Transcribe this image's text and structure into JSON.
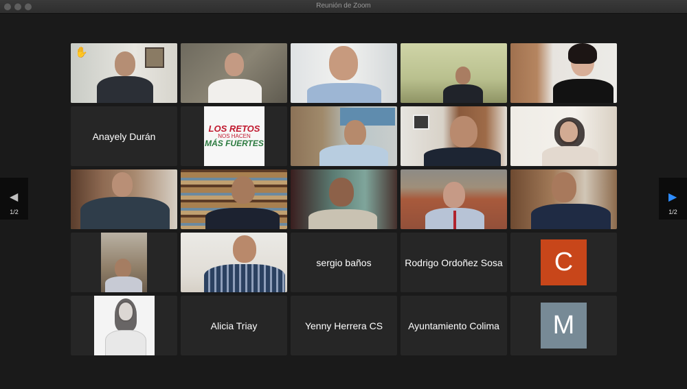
{
  "window": {
    "title": "Reunión de Zoom"
  },
  "nav": {
    "prev": {
      "icon": "chevron-left-icon",
      "page": "1/2",
      "color": "#bfbfbf"
    },
    "next": {
      "icon": "chevron-right-icon",
      "page": "1/2",
      "color": "#2d8cff"
    }
  },
  "tiles": {
    "r1c1": {
      "raised_hand_icon": "hand-raised-icon"
    },
    "r2c1": {
      "name": "Anayely Durán"
    },
    "r2c2": {
      "poster": {
        "line1": "LOS RETOS",
        "line2": "NOS HACEN",
        "line3": "MÁS FUERTES"
      }
    },
    "r4c3": {
      "name": "sergio baños"
    },
    "r4c4": {
      "name": "Rodrigo Ordoñez Sosa"
    },
    "r4c5": {
      "avatar_letter": "C",
      "avatar_color": "#c8461a"
    },
    "r5c2": {
      "name": "Alicia Triay"
    },
    "r5c3": {
      "name": "Yenny Herrera CS"
    },
    "r5c4": {
      "name": "Ayuntamiento Colima"
    },
    "r5c5": {
      "avatar_letter": "M",
      "avatar_color": "#778a96"
    }
  },
  "active_speaker_color": "#5bd35b"
}
